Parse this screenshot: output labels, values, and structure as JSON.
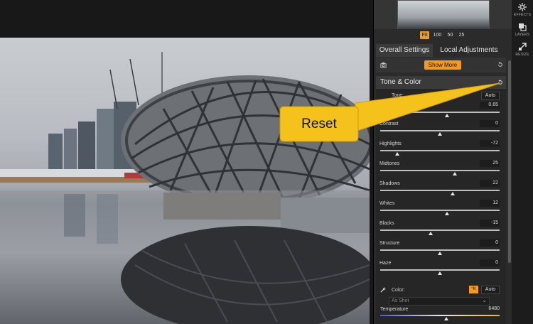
{
  "zoom": {
    "options": [
      "Fit",
      "100",
      "50",
      "25"
    ],
    "selected": "Fit"
  },
  "tabs": [
    {
      "label": "Overall Settings",
      "selected": true
    },
    {
      "label": "Local Adjustments",
      "selected": false
    }
  ],
  "toolbar": {
    "show_more_label": "Show More",
    "tools": [
      {
        "label": "EFFECTS",
        "icon": "effects-icon"
      },
      {
        "label": "LAYERS",
        "icon": "layers-icon"
      },
      {
        "label": "RESIZE",
        "icon": "resize-icon"
      }
    ]
  },
  "tone_color": {
    "title": "Tone & Color",
    "tone_label": "Tone:",
    "tone_auto_label": "Auto",
    "exposure_value": "0.65",
    "sliders": [
      {
        "name": "Contrast",
        "value": "0",
        "level": 0
      },
      {
        "name": "Highlights",
        "value": "-72",
        "level": -72
      },
      {
        "name": "Midtones",
        "value": "25",
        "level": 25
      },
      {
        "name": "Shadows",
        "value": "22",
        "level": 22
      },
      {
        "name": "Whites",
        "value": "12",
        "level": 12
      },
      {
        "name": "Blacks",
        "value": "-15",
        "level": -15
      },
      {
        "name": "Structure",
        "value": "0",
        "level": 0
      },
      {
        "name": "Haze",
        "value": "0",
        "level": 0
      }
    ],
    "color_label": "Color:",
    "color_k_label": "°K",
    "color_auto_label": "Auto",
    "as_shot_label": "As Shot",
    "temperature_label": "Temperature",
    "temperature_value": "6480"
  },
  "callout": {
    "label": "Reset"
  },
  "colors": {
    "accent": "#f39a1f",
    "callout_fill": "#f4c21a",
    "panel": "#2b2b2b"
  }
}
